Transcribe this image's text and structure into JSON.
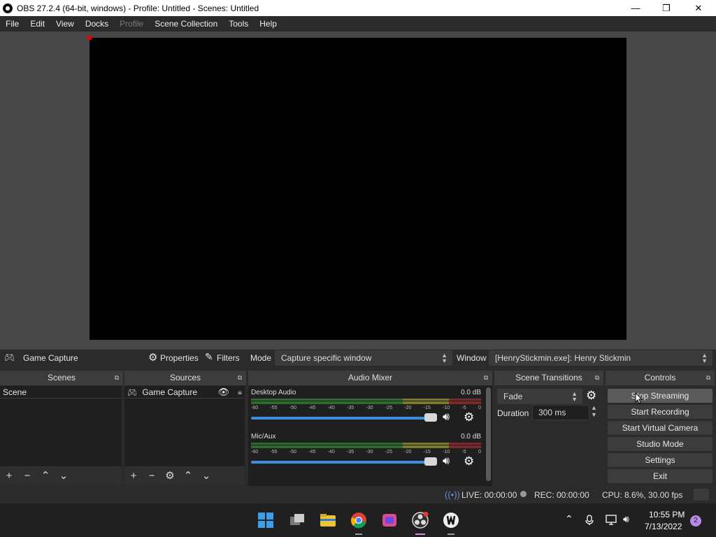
{
  "window": {
    "title": "OBS 27.2.4 (64-bit, windows) - Profile: Untitled - Scenes: Untitled",
    "min": "—",
    "max": "❐",
    "close": "✕"
  },
  "menu": [
    "File",
    "Edit",
    "View",
    "Docks",
    "Profile",
    "Scene Collection",
    "Tools",
    "Help"
  ],
  "source_bar": {
    "source": "Game Capture",
    "properties": "Properties",
    "filters": "Filters",
    "mode_label": "Mode",
    "mode_value": "Capture specific window",
    "window_label": "Window",
    "window_value": "[HenryStickmin.exe]: Henry Stickmin"
  },
  "scenes": {
    "title": "Scenes",
    "items": [
      "Scene"
    ]
  },
  "sources": {
    "title": "Sources",
    "items": [
      "Game Capture"
    ]
  },
  "mixer": {
    "title": "Audio Mixer",
    "ticks": [
      "-60",
      "-55",
      "-50",
      "-45",
      "-40",
      "-35",
      "-30",
      "-25",
      "-20",
      "-15",
      "-10",
      "-5",
      "0"
    ],
    "channels": [
      {
        "name": "Desktop Audio",
        "db": "0.0 dB"
      },
      {
        "name": "Mic/Aux",
        "db": "0.0 dB"
      }
    ]
  },
  "transitions": {
    "title": "Scene Transitions",
    "value": "Fade",
    "duration_label": "Duration",
    "duration_value": "300 ms"
  },
  "controls": {
    "title": "Controls",
    "buttons": [
      "Stop Streaming",
      "Start Recording",
      "Start Virtual Camera",
      "Studio Mode",
      "Settings",
      "Exit"
    ]
  },
  "status": {
    "live": "LIVE: 00:00:00",
    "rec": "REC: 00:00:00",
    "cpu": "CPU: 8.6%, 30.00 fps"
  },
  "taskbar": {
    "time": "10:55 PM",
    "date": "7/13/2022",
    "notifications": "2"
  }
}
